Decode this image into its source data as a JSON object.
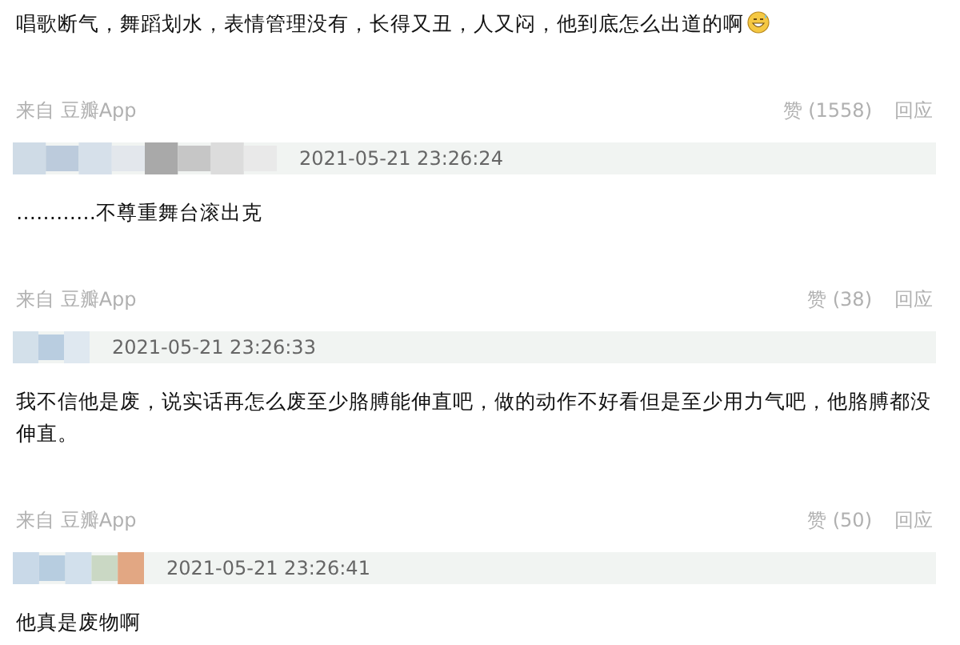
{
  "posts": [
    {
      "text": "唱歌断气，舞蹈划水，表情管理没有，长得又丑，人又闷，他到底怎么出道的啊",
      "trailing_emoji": true,
      "footer": {
        "source": "来自 豆瓣App",
        "likes": "赞 (1558)",
        "reply": "回应"
      }
    },
    {
      "time": "2021-05-21 23:26:24",
      "text": "…………不尊重舞台滚出克",
      "footer": {
        "source": "来自 豆瓣App",
        "likes": "赞 (38)",
        "reply": "回应"
      }
    },
    {
      "time": "2021-05-21 23:26:33",
      "text": "我不信他是废，说实话再怎么废至少胳膊能伸直吧，做的动作不好看但是至少用力气吧，他胳膊都没伸直。",
      "footer": {
        "source": "来自 豆瓣App",
        "likes": "赞 (50)",
        "reply": "回应"
      }
    },
    {
      "time": "2021-05-21 23:26:41",
      "text": "他真是废物啊"
    }
  ]
}
